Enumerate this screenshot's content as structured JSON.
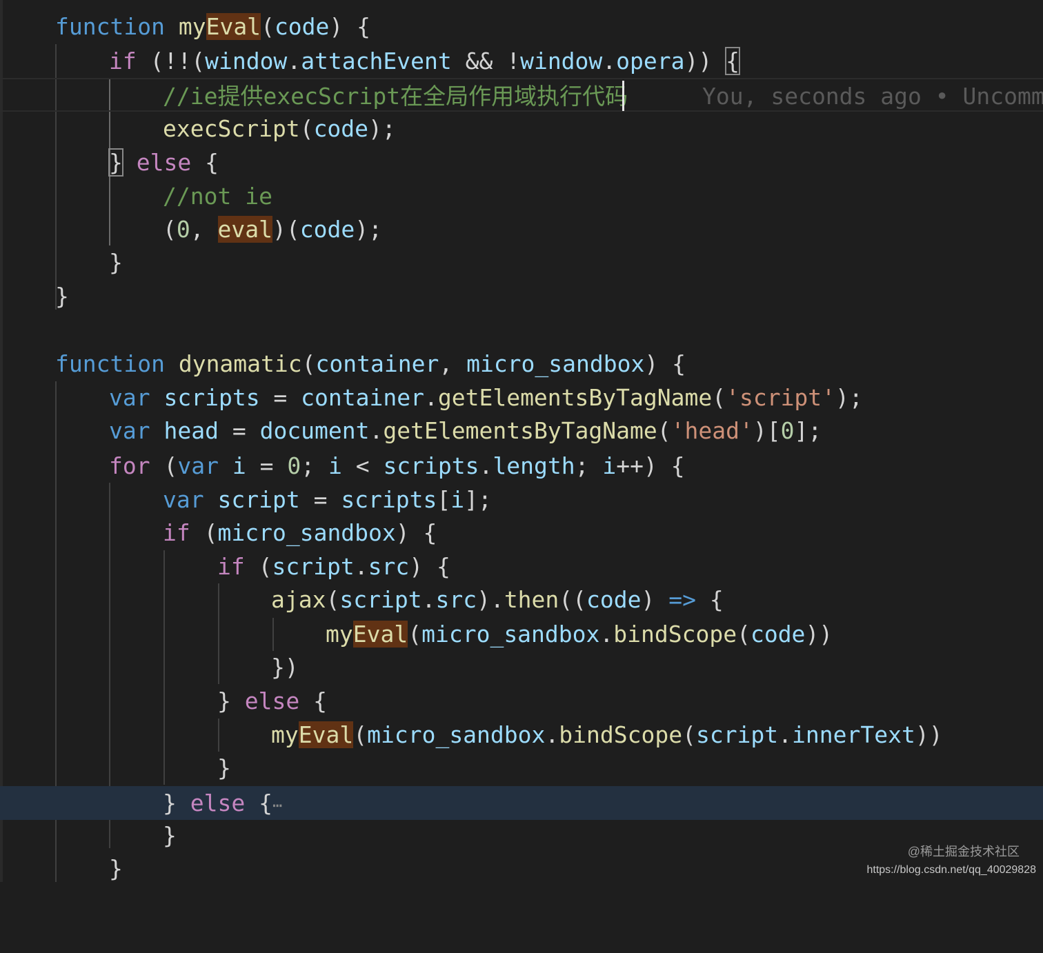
{
  "editor": {
    "blame": "You, seconds ago • Uncomm",
    "fold_ellipsis": "⋯"
  },
  "watermark": {
    "line1": "@稀土掘金技术社区",
    "line2": "https://blog.csdn.net/qq_40029828"
  },
  "code": {
    "l1": {
      "kw": "function",
      "name_a": "my",
      "name_b": "Eval",
      "rest_a": "(",
      "param": "code",
      "rest_b": ") {"
    },
    "l2": {
      "kw": "if",
      "a": " (!!(",
      "b": "window",
      "c": ".",
      "d": "attachEvent",
      "e": " && !",
      "f": "window",
      "g": ".",
      "h": "opera",
      "i": ")) ",
      "j": "{"
    },
    "l3": {
      "comment": "//ie提供execScript在全局作用域执行代码"
    },
    "l4": {
      "fn": "execScript",
      "a": "(",
      "b": "code",
      "c": ");"
    },
    "l5": {
      "brace": "}",
      "kw": "else",
      "rest": " {"
    },
    "l6": {
      "comment": "//not ie"
    },
    "l7": {
      "a": "(",
      "num": "0",
      "b": ", ",
      "eval": "eval",
      "c": ")(",
      "d": "code",
      "e": ");"
    },
    "l8": {
      "text": "}"
    },
    "l9": {
      "text": "}"
    },
    "l11": {
      "kw": "function",
      "fn": "dynamatic",
      "a": "(",
      "p1": "container",
      "b": ", ",
      "p2": "micro_sandbox",
      "c": ") {"
    },
    "l12": {
      "kw": "var",
      "v": "scripts",
      "a": " = ",
      "o": "container",
      "b": ".",
      "m": "getElementsByTagName",
      "c": "(",
      "s": "'script'",
      "d": ");"
    },
    "l13": {
      "kw": "var",
      "v": "head",
      "a": " = ",
      "o": "document",
      "b": ".",
      "m": "getElementsByTagName",
      "c": "(",
      "s": "'head'",
      "d": ")[",
      "n": "0",
      "e": "];"
    },
    "l14": {
      "kw": "for",
      "a": " (",
      "kw2": "var",
      "v": "i",
      "b": " = ",
      "n": "0",
      "c": "; ",
      "v2": "i",
      "d": " < ",
      "o": "scripts",
      "e": ".",
      "p": "length",
      "f": "; ",
      "v3": "i",
      "g": "++) {"
    },
    "l15": {
      "kw": "var",
      "v": "script",
      "a": " = ",
      "o": "scripts",
      "b": "[",
      "i": "i",
      "c": "];"
    },
    "l16": {
      "kw": "if",
      "a": " (",
      "v": "micro_sandbox",
      "b": ") {"
    },
    "l17": {
      "kw": "if",
      "a": " (",
      "o": "script",
      "b": ".",
      "p": "src",
      "c": ") {"
    },
    "l18": {
      "fn": "ajax",
      "a": "(",
      "o": "script",
      "b": ".",
      "p": "src",
      "c": ").",
      "m": "then",
      "d": "((",
      "v": "code",
      "e": ") ",
      "arrow": "=>",
      "f": " {"
    },
    "l19": {
      "name_a": "my",
      "name_b": "Eval",
      "a": "(",
      "o": "micro_sandbox",
      "b": ".",
      "m": "bindScope",
      "c": "(",
      "v": "code",
      "d": "))"
    },
    "l20": {
      "text": "})"
    },
    "l21": {
      "brace": "}",
      "kw": "else",
      "rest": " {"
    },
    "l22": {
      "name_a": "my",
      "name_b": "Eval",
      "a": "(",
      "o": "micro_sandbox",
      "b": ".",
      "m": "bindScope",
      "c": "(",
      "o2": "script",
      "d": ".",
      "p": "innerText",
      "e": "))"
    },
    "l23": {
      "text": "}"
    },
    "l24": {
      "brace": "}",
      "kw": "else",
      "rest": " {"
    },
    "l25": {
      "text": "}"
    },
    "l26": {
      "text": "}"
    }
  }
}
